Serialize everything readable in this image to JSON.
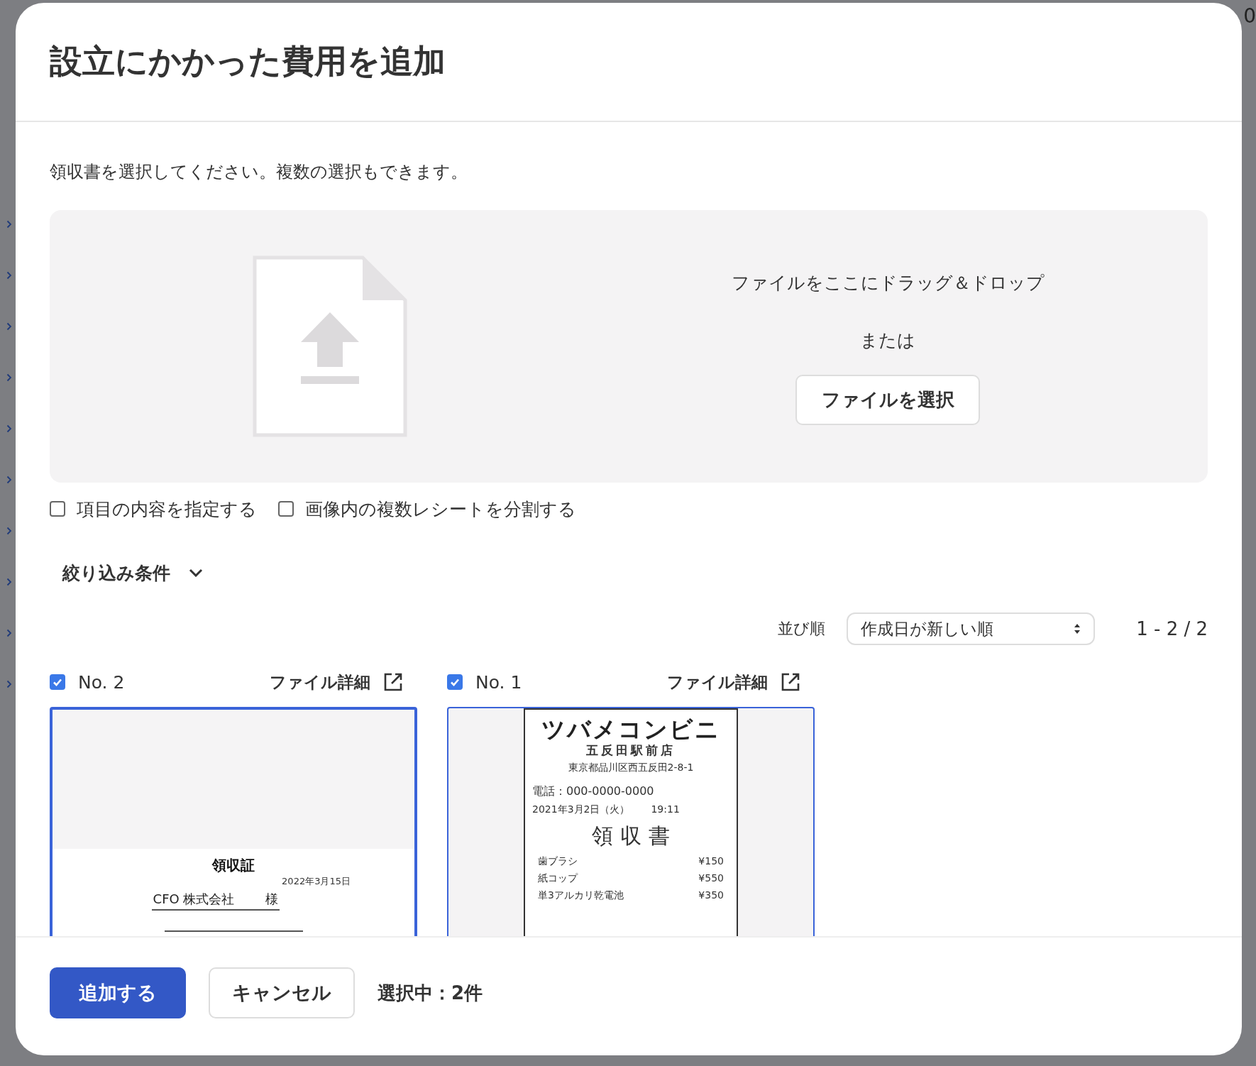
{
  "background": {
    "corner_text": "0"
  },
  "dialog": {
    "title": "設立にかかった費用を追加",
    "instruction": "領収書を選択してください。複数の選択もできます。",
    "dropzone": {
      "prompt": "ファイルをここにドラッグ＆ドロップ",
      "or": "または",
      "button": "ファイルを選択"
    },
    "options": [
      {
        "label": "項目の内容を指定する",
        "checked": false
      },
      {
        "label": "画像内の複数レシートを分割する",
        "checked": false
      }
    ],
    "filter": {
      "label": "絞り込み条件",
      "expanded": false
    },
    "sort": {
      "label": "並び順",
      "value": "作成日が新しい順"
    },
    "count": "1 - 2 / 2",
    "files": [
      {
        "label": "No. 2",
        "checked": true,
        "highlighted": true,
        "detail_link": "ファイル詳細",
        "document": {
          "kind": "certificate",
          "title": "領収証",
          "date": "2022年3月15日",
          "addressee": "CFO 株式会社",
          "honorific": "様"
        }
      },
      {
        "label": "No. 1",
        "checked": true,
        "highlighted": false,
        "detail_link": "ファイル詳細",
        "document": {
          "kind": "receipt",
          "store": "ツバメコンビニ",
          "branch": "五反田駅前店",
          "address": "東京都品川区西五反田2-8-1",
          "phone": "電話：000-0000-0000",
          "date": "2021年3月2日（火）",
          "time": "19:11",
          "title": "領 収 書",
          "items": [
            {
              "name": "歯ブラシ",
              "price": "¥150"
            },
            {
              "name": "紙コップ",
              "price": "¥550"
            },
            {
              "name": "単3アルカリ乾電池",
              "price": "¥350"
            }
          ]
        }
      }
    ],
    "footer": {
      "primary": "追加する",
      "cancel": "キャンセル",
      "status": "選択中：2件"
    }
  }
}
